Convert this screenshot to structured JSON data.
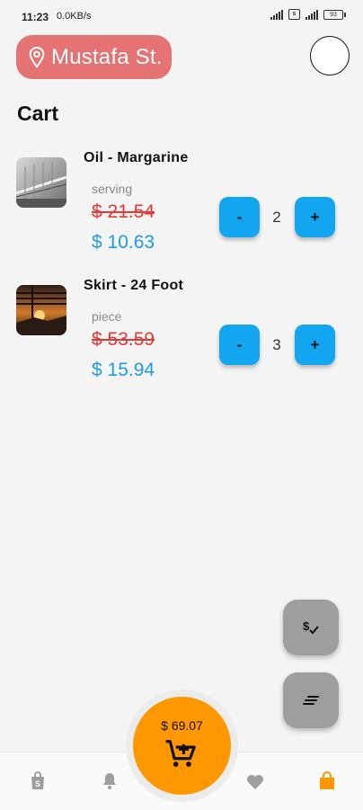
{
  "status_bar": {
    "time": "11:23",
    "network_speed": "0.0KB/s",
    "battery": "93"
  },
  "header": {
    "location": "Mustafa St."
  },
  "page_title": "Cart",
  "cart_items": [
    {
      "name": "Oil - Margarine",
      "unit": "serving",
      "old_price": "$ 21.54",
      "new_price": "$ 10.63",
      "quantity": "2"
    },
    {
      "name": "Skirt - 24 Foot",
      "unit": "piece",
      "old_price": "$ 53.59",
      "new_price": "$ 15.94",
      "quantity": "3"
    }
  ],
  "quantity_controls": {
    "decrement": "-",
    "increment": "+"
  },
  "checkout": {
    "total": "$ 69.07"
  },
  "colors": {
    "location_pill": "#e57373",
    "qty_button": "#12a6f0",
    "old_price": "#e53935",
    "new_price": "#1e9be6",
    "checkout": "#ff9800",
    "fab": "#9e9e9e",
    "active_nav": "#ff9800"
  },
  "icons": {
    "location": "map-pin-icon",
    "fab_top": "price-check-icon",
    "fab_bottom": "sort-lines-icon",
    "nav": [
      "shop-icon",
      "bell-icon",
      "heart-icon",
      "shopping-bag-icon"
    ],
    "checkout": "add-to-cart-icon"
  }
}
